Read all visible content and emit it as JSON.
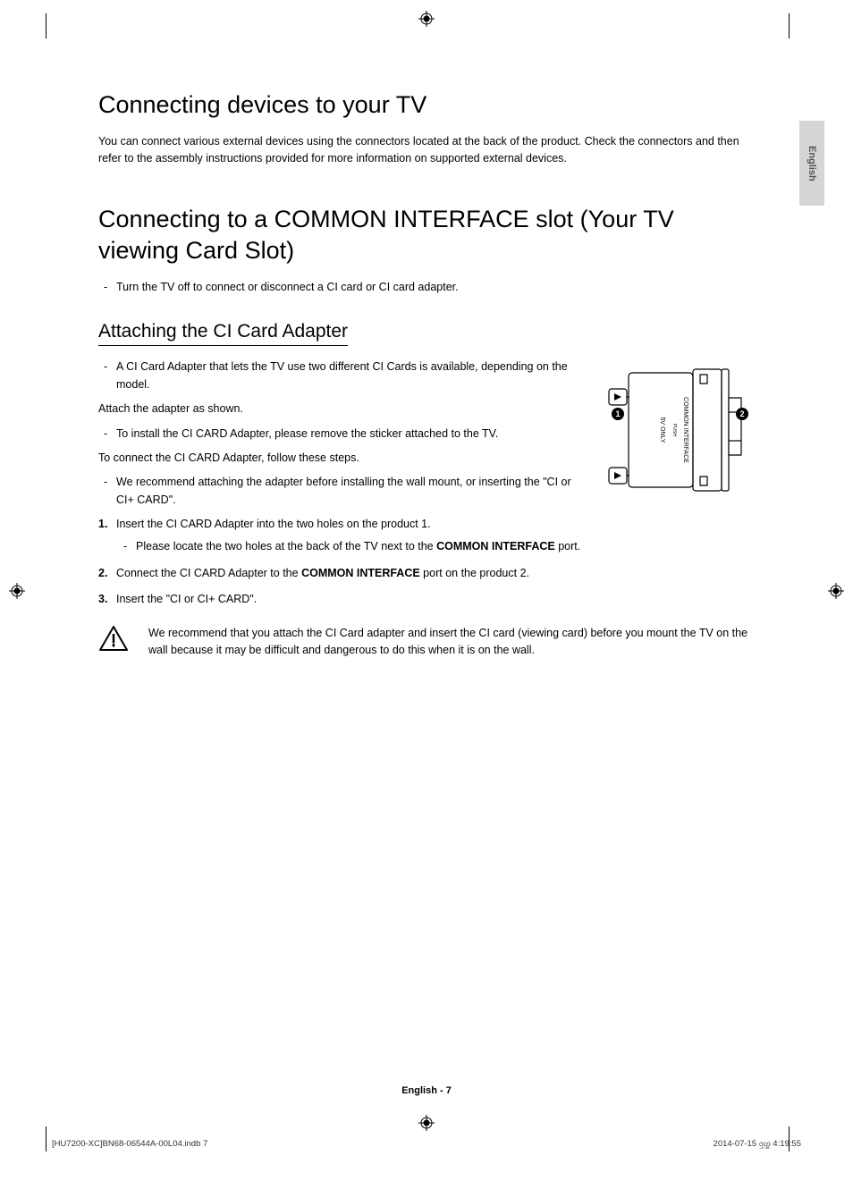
{
  "heading1": "Connecting devices to your TV",
  "intro": "You can connect various external devices using the connectors located at the back of the product. Check the connectors and then refer to the assembly instructions provided for more information on supported external devices.",
  "heading2": "Connecting to a COMMON INTERFACE slot (Your TV viewing Card Slot)",
  "h2_dash": "Turn the TV off to connect or disconnect a CI card or CI card adapter.",
  "h3": "Attaching the CI Card Adapter",
  "h3_dash1": "A CI Card Adapter that lets the TV use two different CI Cards is available, depending on the model.",
  "attach_line": "Attach the adapter as shown.",
  "h3_dash2": "To install the CI CARD Adapter, please remove the sticker attached to the TV.",
  "connect_line": "To connect the CI CARD Adapter, follow these steps.",
  "h3_dash3": "We recommend attaching the adapter before installing the wall mount, or inserting the \"CI or CI+ CARD\".",
  "step1": "Insert the CI CARD Adapter into the two holes on the product 1.",
  "step1_sub": "Please locate the two holes at the back of the TV next to the ",
  "step1_sub_bold": "COMMON INTERFACE",
  "step1_sub_tail": " port.",
  "step2_a": "Connect the CI CARD Adapter to the ",
  "step2_bold": "COMMON INTERFACE",
  "step2_b": " port on the product 2.",
  "step3": "Insert the \"CI or CI+ CARD\".",
  "callout": "We recommend that you attach the CI Card adapter and insert the CI card (viewing card) before you mount the TV on the wall because it may be difficult and dangerous to do this when it is on the wall.",
  "diagram": {
    "label_common": "COMMON INTERFACE",
    "label_5v": "5V ONLY",
    "label_push": "PUSH",
    "marker1": "1",
    "marker2": "2"
  },
  "lang_tab": "English",
  "footer_center": "English - 7",
  "footer_file": "[HU7200-XC]BN68-06544A-00L04.indb   7",
  "footer_date": "2014-07-15   ᦋᦄ 4:19:55"
}
